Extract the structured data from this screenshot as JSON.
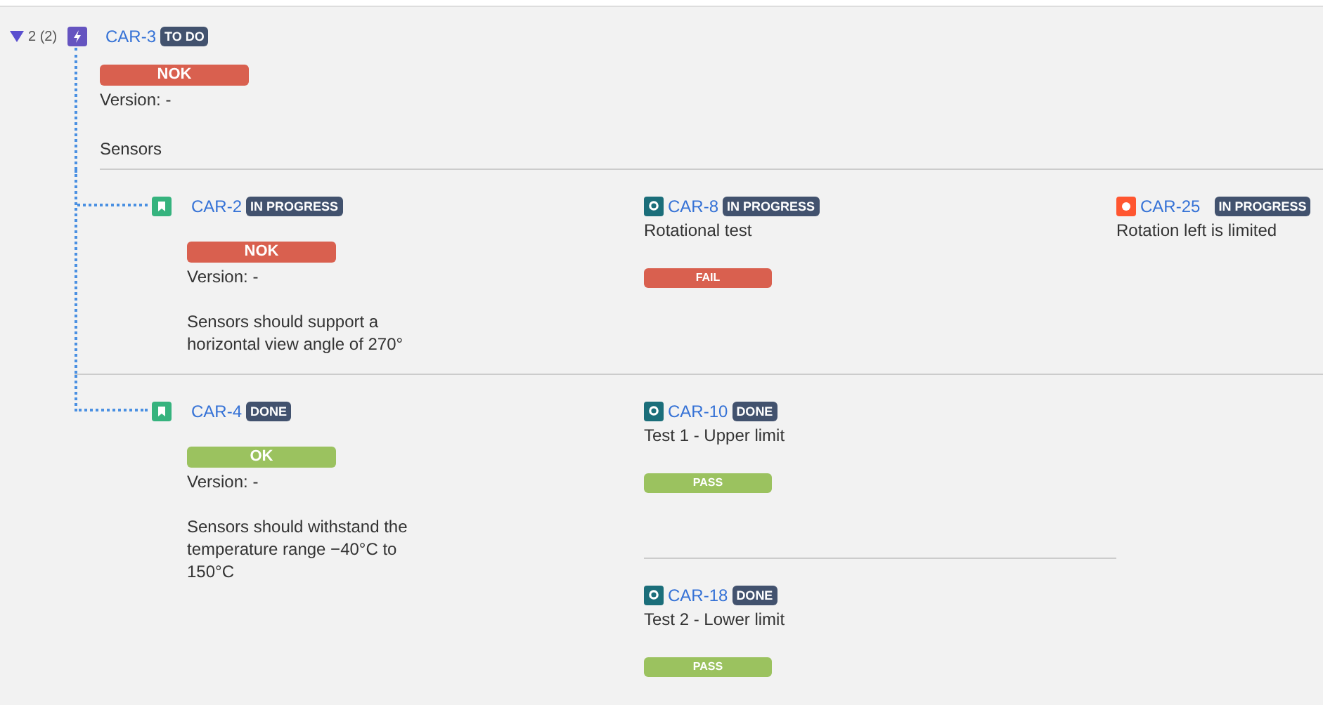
{
  "epic": {
    "toggle": {
      "expanded": true,
      "count": "2 (2)"
    },
    "kind": "epic",
    "key": "CAR-3",
    "status": "TO DO",
    "result": {
      "label": "NOK",
      "kind": "nok"
    },
    "version": "Version: -",
    "summary": "Sensors"
  },
  "requirements": [
    {
      "kind": "story",
      "key": "CAR-2",
      "status": "IN PROGRESS",
      "result": {
        "label": "NOK",
        "kind": "nok"
      },
      "version": "Version: -",
      "description": "Sensors should support a horizontal view angle of 270°",
      "tests": [
        {
          "kind": "test",
          "key": "CAR-8",
          "status": "IN PROGRESS",
          "title": "Rotational test",
          "result": {
            "label": "FAIL",
            "kind": "fail"
          }
        }
      ],
      "defects": [
        {
          "kind": "bug",
          "key": "CAR-25",
          "status": "IN PROGRESS",
          "title": "Rotation left is limited"
        }
      ]
    },
    {
      "kind": "story",
      "key": "CAR-4",
      "status": "DONE",
      "result": {
        "label": "OK",
        "kind": "ok"
      },
      "version": "Version: -",
      "description": "Sensors should withstand the temperature range −40°C to 150°C",
      "tests": [
        {
          "kind": "test",
          "key": "CAR-10",
          "status": "DONE",
          "title": "Test 1 - Upper limit",
          "result": {
            "label": "PASS",
            "kind": "pass"
          }
        },
        {
          "kind": "test",
          "key": "CAR-18",
          "status": "DONE",
          "title": "Test 2 - Lower limit",
          "result": {
            "label": "PASS",
            "kind": "pass"
          }
        }
      ]
    }
  ]
}
